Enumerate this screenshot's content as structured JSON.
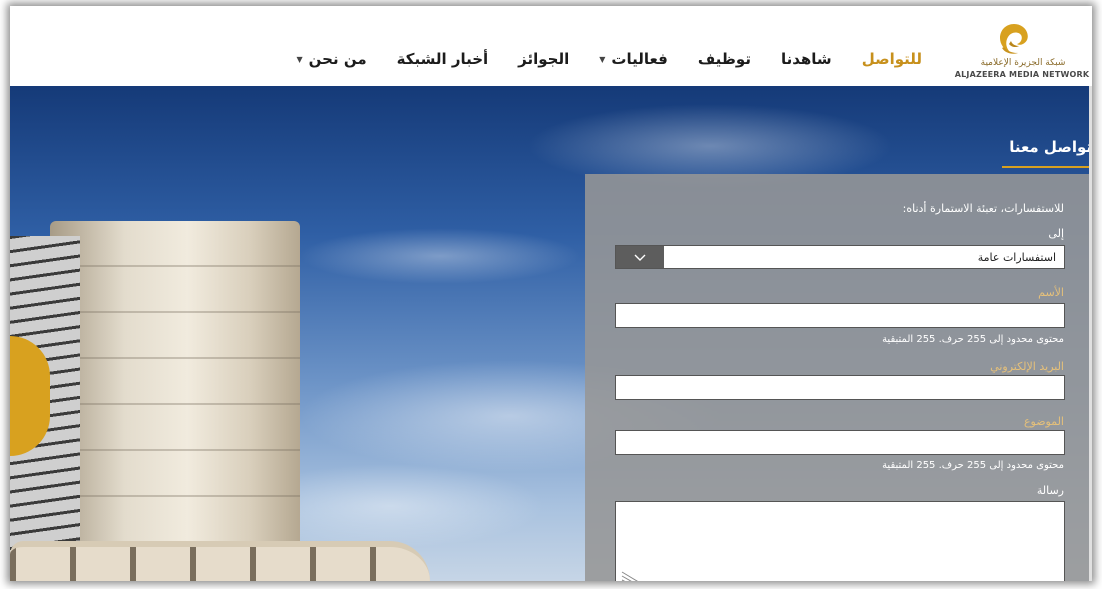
{
  "header": {
    "logo": {
      "name_ar": "شبكة الجزيرة الإعلامية",
      "name_en": "ALJAZEERA MEDIA NETWORK"
    },
    "nav": [
      {
        "label": "من نحن",
        "dropdown": true,
        "active": false
      },
      {
        "label": "أخبار الشبكة",
        "dropdown": false,
        "active": false
      },
      {
        "label": "الجوائز",
        "dropdown": false,
        "active": false
      },
      {
        "label": "فعاليات",
        "dropdown": true,
        "active": false
      },
      {
        "label": "توظيف",
        "dropdown": false,
        "active": false
      },
      {
        "label": "شاهدنا",
        "dropdown": false,
        "active": false
      },
      {
        "label": "للتواصل",
        "dropdown": false,
        "active": true
      }
    ]
  },
  "contact": {
    "title": "تواصل معنا",
    "intro": "للاستفسارات، تعبئة الاستمارة أدناه:",
    "to_label": "إلى",
    "to_value": "استفسارات عامة",
    "name_label": "الأسم",
    "name_hint": "محتوى محدود إلى 255 حرف. 255 المتبقية",
    "email_label": "البريد الإلكتروني",
    "subject_label": "الموضوع",
    "subject_hint": "محتوى محدود إلى 255 حرف. 255 المتبقية",
    "message_label": "رسالة"
  },
  "colors": {
    "accent_gold": "#d8a11f",
    "active_nav": "#c7901c",
    "form_bg": "#969696"
  }
}
